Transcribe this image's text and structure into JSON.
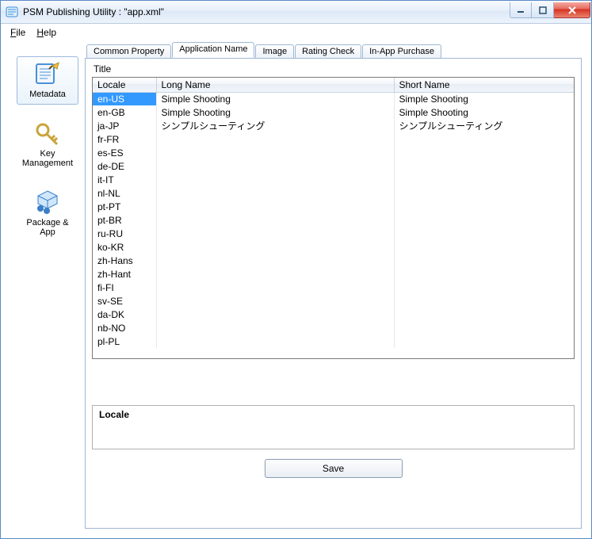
{
  "window": {
    "title": "PSM Publishing Utility : \"app.xml\""
  },
  "menu": {
    "file": "File",
    "help": "Help"
  },
  "sidebar": {
    "items": [
      {
        "label": "Metadata",
        "selected": true
      },
      {
        "label": "Key\nManagement",
        "selected": false
      },
      {
        "label": "Package &\nApp",
        "selected": false
      }
    ]
  },
  "tabs": {
    "items": [
      {
        "label": "Common Property",
        "active": false
      },
      {
        "label": "Application Name",
        "active": true
      },
      {
        "label": "Image",
        "active": false
      },
      {
        "label": "Rating Check",
        "active": false
      },
      {
        "label": "In-App Purchase",
        "active": false
      }
    ]
  },
  "grid": {
    "title": "Title",
    "columns": {
      "locale": "Locale",
      "long": "Long Name",
      "short": "Short Name"
    },
    "rows": [
      {
        "locale": "en-US",
        "long": "Simple Shooting",
        "short": "Simple Shooting",
        "selected": true
      },
      {
        "locale": "en-GB",
        "long": "Simple Shooting",
        "short": "Simple Shooting"
      },
      {
        "locale": "ja-JP",
        "long": "シンプルシューティング",
        "short": "シンプルシューティング"
      },
      {
        "locale": "fr-FR",
        "long": "",
        "short": ""
      },
      {
        "locale": "es-ES",
        "long": "",
        "short": ""
      },
      {
        "locale": "de-DE",
        "long": "",
        "short": ""
      },
      {
        "locale": "it-IT",
        "long": "",
        "short": ""
      },
      {
        "locale": "nl-NL",
        "long": "",
        "short": ""
      },
      {
        "locale": "pt-PT",
        "long": "",
        "short": ""
      },
      {
        "locale": "pt-BR",
        "long": "",
        "short": ""
      },
      {
        "locale": "ru-RU",
        "long": "",
        "short": ""
      },
      {
        "locale": "ko-KR",
        "long": "",
        "short": ""
      },
      {
        "locale": "zh-Hans",
        "long": "",
        "short": ""
      },
      {
        "locale": "zh-Hant",
        "long": "",
        "short": ""
      },
      {
        "locale": "fi-FI",
        "long": "",
        "short": ""
      },
      {
        "locale": "sv-SE",
        "long": "",
        "short": ""
      },
      {
        "locale": "da-DK",
        "long": "",
        "short": ""
      },
      {
        "locale": "nb-NO",
        "long": "",
        "short": ""
      },
      {
        "locale": "pl-PL",
        "long": "",
        "short": ""
      }
    ]
  },
  "locale_panel": {
    "title": "Locale"
  },
  "buttons": {
    "save": "Save"
  }
}
